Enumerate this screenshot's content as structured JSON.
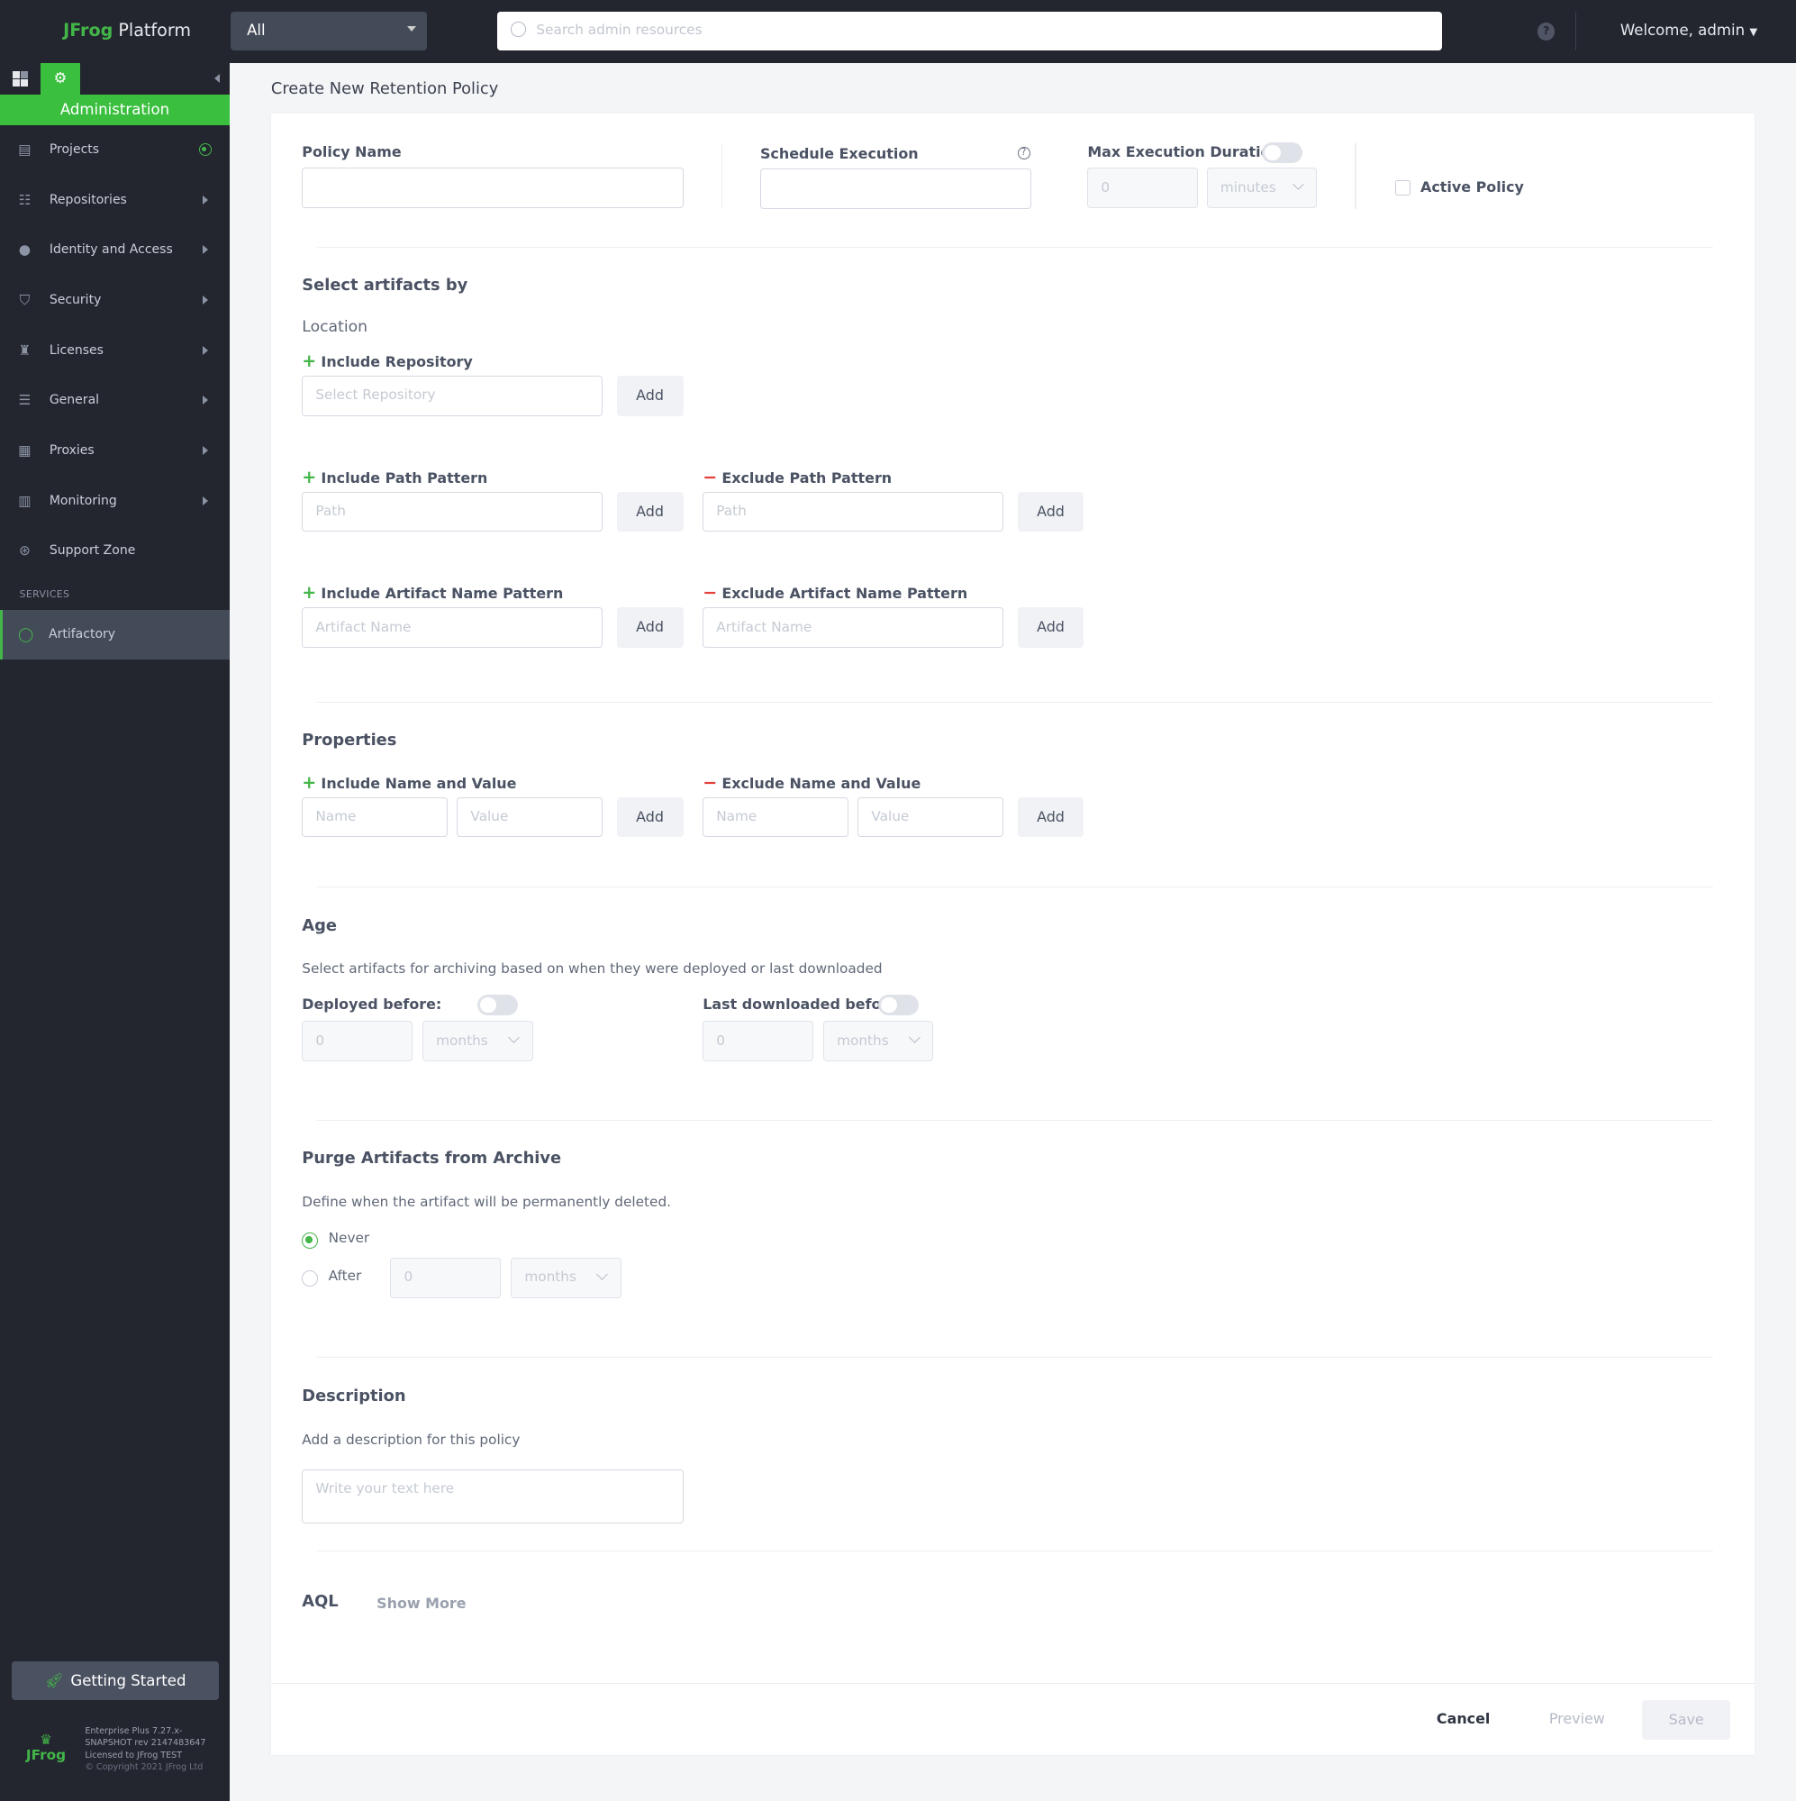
{
  "header": {
    "brand_prefix": "JFrog",
    "brand_suffix": "Platform",
    "scope_select": "All",
    "search_placeholder": "Search admin resources",
    "help": "?",
    "welcome": "Welcome, admin"
  },
  "sidebar": {
    "section": "Administration",
    "items": [
      {
        "label": "Projects",
        "icon": "projects-icon"
      },
      {
        "label": "Repositories",
        "icon": "repositories-icon"
      },
      {
        "label": "Identity and Access",
        "icon": "user-icon"
      },
      {
        "label": "Security",
        "icon": "shield-icon"
      },
      {
        "label": "Licenses",
        "icon": "badge-icon"
      },
      {
        "label": "General",
        "icon": "sliders-icon"
      },
      {
        "label": "Proxies",
        "icon": "server-icon"
      },
      {
        "label": "Monitoring",
        "icon": "bar-chart-icon"
      },
      {
        "label": "Support Zone",
        "icon": "lifebuoy-icon"
      }
    ],
    "services_label": "SERVICES",
    "active_service": "Artifactory",
    "getting_started": "Getting Started",
    "footer": {
      "logo": "JFrog",
      "line1": "Enterprise Plus 7.27.x-",
      "line2": "SNAPSHOT rev 2147483647",
      "line3": "Licensed to JFrog TEST",
      "copyright": "© Copyright 2021 JFrog Ltd"
    },
    "accent": "#3bbf3f"
  },
  "page": {
    "title": "Create New Retention Policy",
    "policy_name": {
      "label": "Policy Name",
      "value": ""
    },
    "schedule": {
      "label": "Schedule Execution",
      "value": ""
    },
    "max_duration": {
      "label": "Max Execution Duration",
      "enabled": false,
      "value": "0",
      "unit": "minutes"
    },
    "active_policy": {
      "label": "Active Policy",
      "checked": false
    },
    "select_by": "Select artifacts by",
    "location": {
      "title": "Location",
      "include_repo": "Include Repository",
      "repo_placeholder": "Select Repository",
      "include_path": "Include Path Pattern",
      "exclude_path": "Exclude Path Pattern",
      "path_placeholder": "Path",
      "include_name": "Include Artifact Name Pattern",
      "exclude_name": "Exclude Artifact Name Pattern",
      "name_placeholder": "Artifact Name"
    },
    "add": "Add",
    "properties": {
      "title": "Properties",
      "include": "Include Name and Value",
      "exclude": "Exclude Name and Value",
      "name_placeholder": "Name",
      "value_placeholder": "Value"
    },
    "age": {
      "title": "Age",
      "desc": "Select artifacts for archiving based on when they were deployed or last downloaded",
      "deployed": {
        "label": "Deployed before:",
        "enabled": false,
        "value": "0",
        "unit": "months"
      },
      "downloaded": {
        "label": "Last downloaded before:",
        "enabled": false,
        "value": "0",
        "unit": "months"
      }
    },
    "purge": {
      "title": "Purge Artifacts from Archive",
      "desc": "Define when the artifact will be permanently deleted.",
      "never": "Never",
      "after": "After",
      "selected": "Never",
      "value": "0",
      "unit": "months"
    },
    "description": {
      "title": "Description",
      "desc": "Add a description for this policy",
      "placeholder": "Write your text here"
    },
    "aql": {
      "title": "AQL",
      "show_more": "Show More"
    },
    "actions": {
      "cancel": "Cancel",
      "preview": "Preview",
      "save": "Save"
    }
  }
}
